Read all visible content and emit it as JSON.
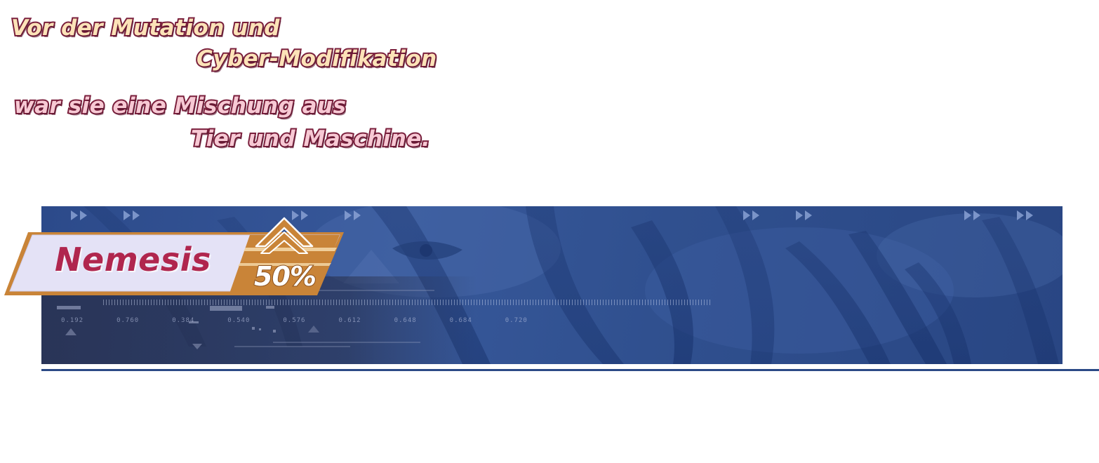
{
  "intro": {
    "line1": "Vor der Mutation und",
    "line2": "Cyber-Modifikation",
    "line3": "war sie eine Mischung aus",
    "line4": "Tier und Maschine."
  },
  "nametag": {
    "name": "Nemesis",
    "percent": "50%",
    "colors": {
      "plate": "#e4e2f6",
      "accent": "#c98438",
      "name_text": "#b0264e"
    }
  },
  "banner": {
    "icon": "fast-forward-arrows-icon",
    "colors": {
      "background": "#2f4f90",
      "divider": "#2b4a86"
    }
  },
  "hud": {
    "readouts": [
      "0.192",
      "0.760",
      "0.384",
      "0.540",
      "0.576",
      "0.612",
      "0.648",
      "0.684",
      "0.720"
    ]
  }
}
